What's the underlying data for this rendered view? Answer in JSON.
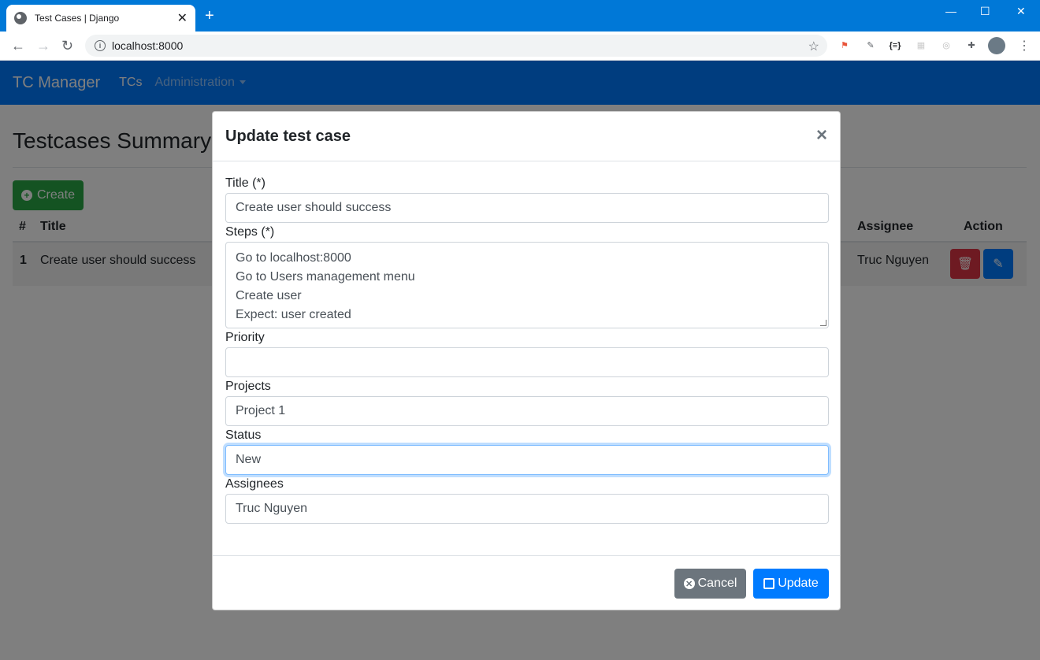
{
  "browser": {
    "tab_title": "Test Cases | Django",
    "url": "localhost:8000",
    "new_tab": "+",
    "close_tab": "✕"
  },
  "app": {
    "brand": "TC Manager",
    "nav": [
      {
        "label": "TCs"
      },
      {
        "label": "Administration"
      }
    ]
  },
  "page": {
    "heading": "Testcases Summary",
    "create_label": "Create",
    "table": {
      "headers": [
        "#",
        "Title",
        "Assignee",
        "Action"
      ],
      "rows": [
        {
          "num": "1",
          "title": "Create user should success",
          "assignee": "Truc Nguyen"
        }
      ]
    }
  },
  "modal": {
    "title": "Update test case",
    "close": "×",
    "fields": {
      "title_label": "Title (*)",
      "title_value": "Create user should success",
      "steps_label": "Steps (*)",
      "steps_lines": [
        "Go to localhost:8000",
        "Go to Users management menu",
        "Create user",
        "Expect: user created"
      ],
      "priority_label": "Priority",
      "priority_value": "",
      "projects_label": "Projects",
      "projects_value": "Project 1",
      "status_label": "Status",
      "status_value": "New",
      "assignees_label": "Assignees",
      "assignees_value": "Truc Nguyen"
    },
    "cancel_label": "Cancel",
    "update_label": "Update"
  },
  "colors": {
    "primary": "#007bff",
    "success": "#28a745",
    "danger": "#dc3545",
    "secondary": "#6c757d",
    "browser_accent": "#0078d7"
  }
}
